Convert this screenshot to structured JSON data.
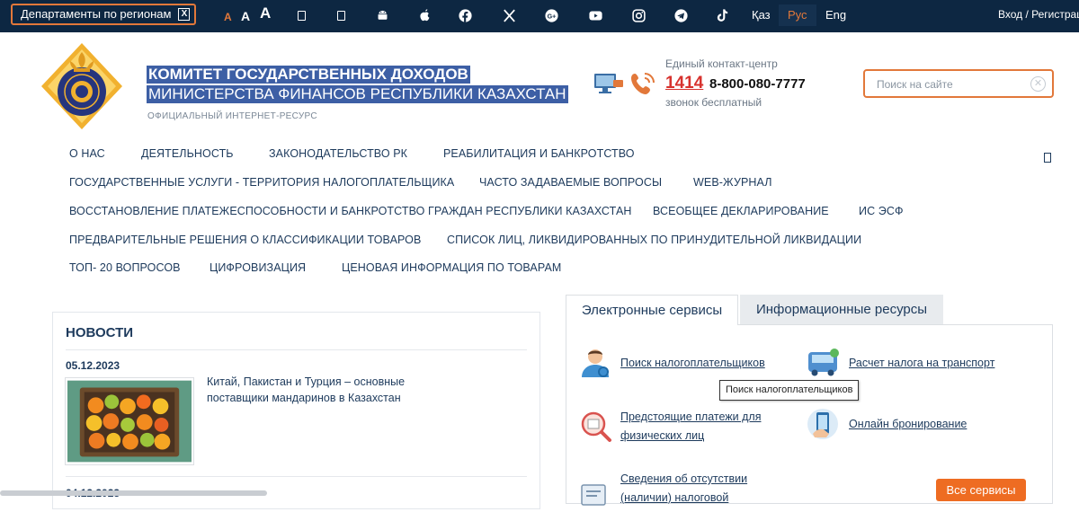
{
  "topbar": {
    "departments_label": "Департаменты по регионам",
    "departments_toggle": "X",
    "font_sizes": [
      "A",
      "A",
      "A"
    ],
    "socials": [
      "android-icon",
      "apple-icon",
      "facebook-icon",
      "x-icon",
      "google-plus-icon",
      "youtube-icon",
      "instagram-icon",
      "telegram-icon",
      "tiktok-icon"
    ],
    "languages": [
      "Қаз",
      "Рус",
      "Eng"
    ],
    "active_language": "Рус",
    "login": "Вход / Регистрац"
  },
  "header": {
    "title": "КОМИТЕТ ГОСУДАРСТВЕННЫХ ДОХОДОВ",
    "subtitle": "МИНИСТЕРСТВА ФИНАНСОВ РЕСПУБЛИКИ КАЗАХСТАН",
    "label": "ОФИЦИАЛЬНЫЙ ИНТЕРНЕТ-РЕСУРС",
    "contact": {
      "title": "Единый контакт-центр",
      "short_number": "1414",
      "phone": "8-800-080-7777",
      "note": "звонок бесплатный"
    },
    "search_placeholder": "Поиск на сайте"
  },
  "nav": {
    "items": [
      "О НАС",
      "ДЕЯТЕЛЬНОСТЬ",
      "ЗАКОНОДАТЕЛЬСТВО РК",
      "РЕАБИЛИТАЦИЯ И БАНКРОТСТВО",
      "ГОСУДАРСТВЕННЫЕ УСЛУГИ - ТЕРРИТОРИЯ НАЛОГОПЛАТЕЛЬЩИКА",
      "ЧАСТО ЗАДАВАЕМЫЕ ВОПРОСЫ",
      "WEB-ЖУРНАЛ",
      "ВОССТАНОВЛЕНИЕ ПЛАТЕЖЕСПОСОБНОСТИ И БАНКРОТСТВО ГРАЖДАН РЕСПУБЛИКИ КАЗАХСТАН",
      "ВСЕОБЩЕЕ ДЕКЛАРИРОВАНИЕ",
      "ИС ЭСФ",
      "ПРЕДВАРИТЕЛЬНЫЕ РЕШЕНИЯ О КЛАССИФИКАЦИИ ТОВАРОВ",
      "СПИСОК ЛИЦ, ЛИКВИДИРОВАННЫХ ПО ПРИНУДИТЕЛЬНОЙ ЛИКВИДАЦИИ",
      "ТОП- 20 ВОПРОСОВ",
      "ЦИФРОВИЗАЦИЯ",
      "ЦЕНОВАЯ ИНФОРМАЦИЯ ПО ТОВАРАМ"
    ]
  },
  "news": {
    "title": "НОВОСТИ",
    "items": [
      {
        "date": "05.12.2023",
        "text": "Китай, Пакистан и Турция – основные поставщики мандаринов в Казахстан"
      },
      {
        "date": "04.12.2023"
      }
    ]
  },
  "services": {
    "tabs": [
      "Электронные сервисы",
      "Информационные ресурсы"
    ],
    "items": [
      {
        "label": "Поиск налогоплательщиков",
        "icon": "user-search-icon"
      },
      {
        "label": "Расчет налога на транспорт",
        "icon": "vehicle-tax-icon"
      },
      {
        "label": "Предстоящие платежи для физических лиц",
        "icon": "payments-search-icon"
      },
      {
        "label": "Онлайн бронирование",
        "icon": "online-booking-icon"
      },
      {
        "label": "Сведения об отсутствии (наличии) налоговой",
        "icon": "tax-debt-info-icon"
      }
    ],
    "tooltip": "Поиск налогоплательщиков",
    "all_button": "Все сервисы"
  },
  "colors": {
    "topbar_bg": "#0d2742",
    "accent": "#e2783a",
    "text": "#1d3a5c",
    "selection": "#3d5fa5",
    "phone_red": "#d7322e",
    "button_orange": "#ee6c22"
  }
}
